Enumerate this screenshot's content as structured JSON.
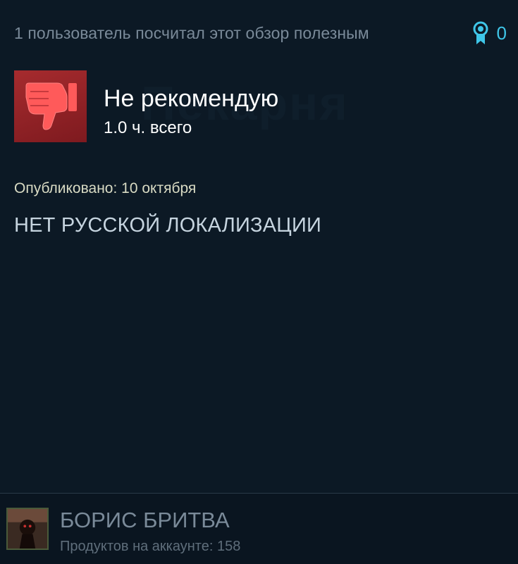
{
  "header": {
    "helpful_text": "1 пользователь посчитал этот обзор полезным",
    "award_count": "0",
    "award_icon": "award-ribbon-icon",
    "accent_color": "#3fc6e8"
  },
  "watermark": {
    "text": "Пекарня"
  },
  "verdict": {
    "icon": "thumbs-down-icon",
    "icon_bg_color": "#a62b2e",
    "title": "Не рекомендую",
    "hours": "1.0 ч. всего"
  },
  "review": {
    "posted": "Опубликовано: 10 октября",
    "body": "НЕТ РУССКОЙ ЛОКАЛИЗАЦИИ"
  },
  "author": {
    "name": "БОРИС БРИТВА",
    "products": "Продуктов на аккаунте: 158"
  }
}
